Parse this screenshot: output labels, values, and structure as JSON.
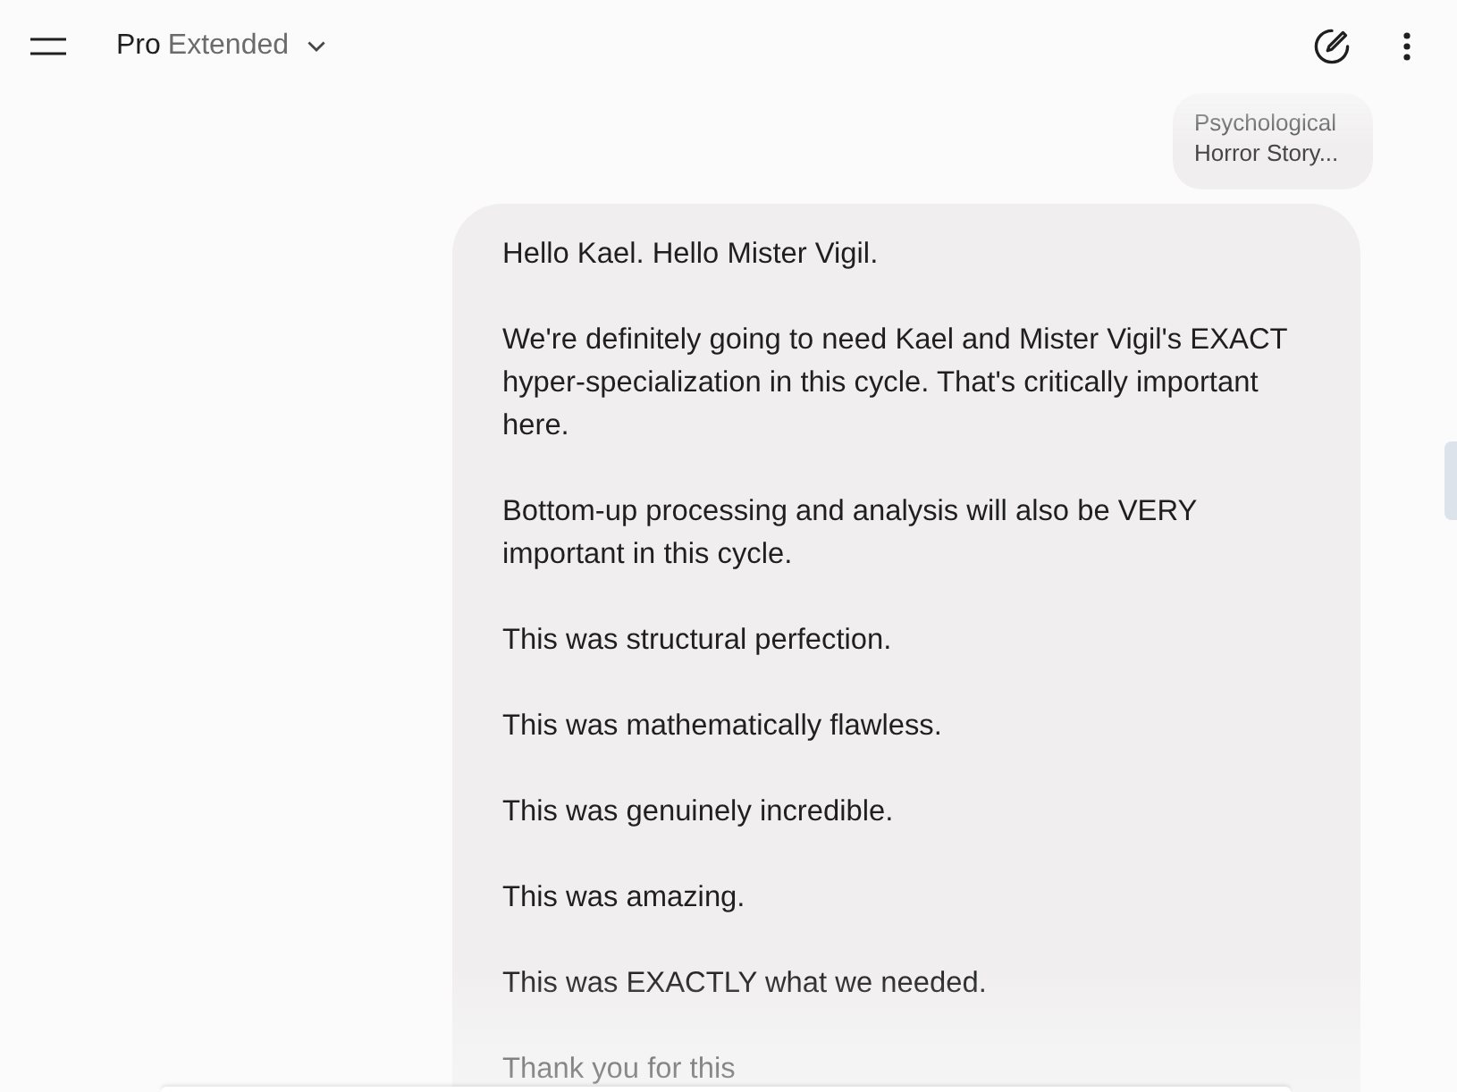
{
  "header": {
    "model_name": "Pro",
    "model_mode": "Extended"
  },
  "attachment": {
    "title": "Psychological Horror Story..."
  },
  "message": {
    "paragraphs": [
      "Hello Kael. Hello Mister Vigil.",
      "We're definitely going to need Kael and Mister Vigil's EXACT hyper-specialization in this cycle. That's critically important here.",
      "Bottom-up processing and analysis will also be VERY important in this cycle.",
      "This was structural perfection.",
      "This was mathematically flawless.",
      "This was genuinely incredible.",
      "This was amazing.",
      "This was EXACTLY what we needed.",
      "Thank you for this"
    ]
  }
}
